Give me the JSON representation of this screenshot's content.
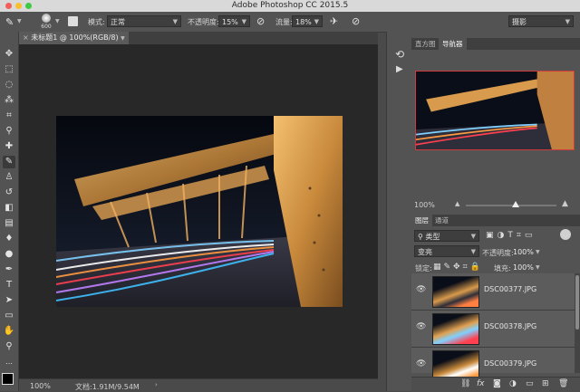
{
  "window": {
    "title": "Adobe Photoshop CC 2015.5"
  },
  "options": {
    "brush_size": "600",
    "mode_label": "模式:",
    "mode_value": "正常",
    "opacity_label": "不透明度:",
    "opacity_value": "15%",
    "flow_label": "流量:",
    "flow_value": "18%",
    "workspace": "摄影"
  },
  "document": {
    "tab_title": "未标题1 @ 100%(RGB/8)",
    "zoom": "100%",
    "doc_size": "文档:1.91M/9.54M"
  },
  "navigator": {
    "tabs": [
      "直方图",
      "导航器"
    ],
    "zoom": "100%",
    "zoom_fraction": 0.55
  },
  "layers": {
    "tabs": [
      "图层",
      "通道"
    ],
    "filter_label": "类型",
    "blend_mode": "变亮",
    "opacity_label": "不透明度:",
    "opacity_value": "100%",
    "lock_label": "锁定:",
    "fill_label": "填充:",
    "fill_value": "100%",
    "items": [
      {
        "name": "DSC00377.JPG"
      },
      {
        "name": "DSC00378.JPG"
      },
      {
        "name": "DSC00379.JPG"
      }
    ]
  },
  "colors": {
    "accent": "#cf3a3a",
    "panel_bg": "#535353",
    "canvas_bg": "#282828"
  }
}
